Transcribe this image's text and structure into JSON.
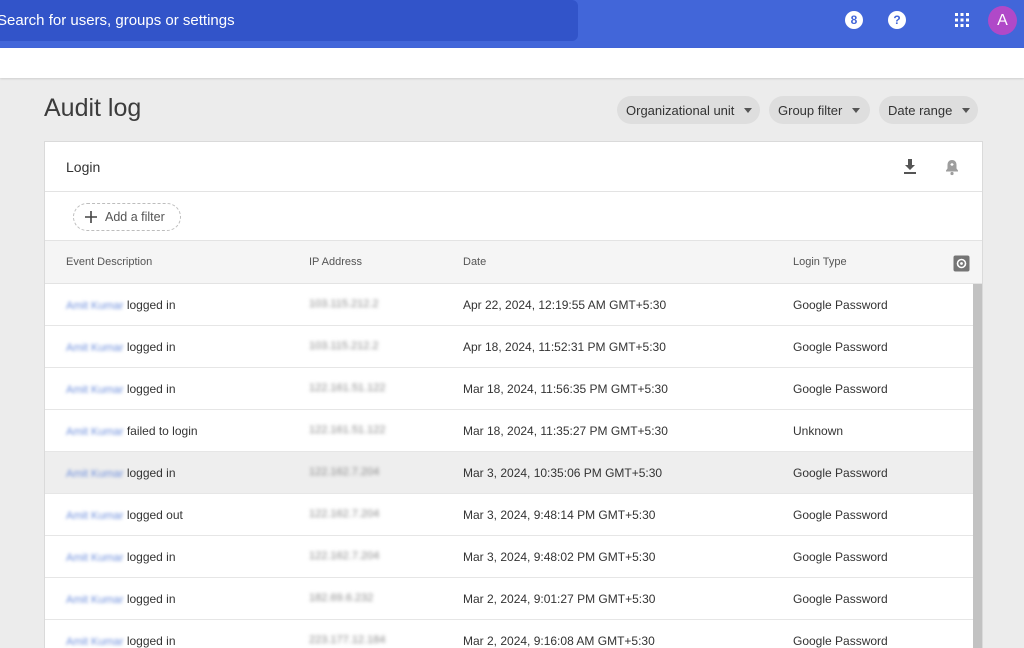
{
  "topbar": {
    "search_placeholder": "Search for users, groups or settings",
    "status_glyph": "8",
    "help_glyph": "?",
    "avatar_letter": "A"
  },
  "page": {
    "title": "Audit log"
  },
  "filters": {
    "org_unit": "Organizational unit",
    "group": "Group filter",
    "date_range": "Date range"
  },
  "card": {
    "title": "Login",
    "add_filter": "Add a filter"
  },
  "table": {
    "headers": {
      "event": "Event Description",
      "ip": "IP Address",
      "date": "Date",
      "login_type": "Login Type"
    },
    "rows": [
      {
        "user": "Amit Kumar",
        "action": "logged in",
        "ip": "103.115.212.2",
        "date": "Apr 22, 2024, 12:19:55 AM GMT+5:30",
        "type": "Google Password"
      },
      {
        "user": "Amit Kumar",
        "action": "logged in",
        "ip": "103.115.212.2",
        "date": "Apr 18, 2024, 11:52:31 PM GMT+5:30",
        "type": "Google Password"
      },
      {
        "user": "Amit Kumar",
        "action": "logged in",
        "ip": "122.161.51.122",
        "date": "Mar 18, 2024, 11:56:35 PM GMT+5:30",
        "type": "Google Password"
      },
      {
        "user": "Amit Kumar",
        "action": "failed to login",
        "ip": "122.161.51.122",
        "date": "Mar 18, 2024, 11:35:27 PM GMT+5:30",
        "type": "Unknown"
      },
      {
        "user": "Amit Kumar",
        "action": "logged in",
        "ip": "122.162.7.204",
        "date": "Mar 3, 2024, 10:35:06 PM GMT+5:30",
        "type": "Google Password"
      },
      {
        "user": "Amit Kumar",
        "action": "logged out",
        "ip": "122.162.7.204",
        "date": "Mar 3, 2024, 9:48:14 PM GMT+5:30",
        "type": "Google Password"
      },
      {
        "user": "Amit Kumar",
        "action": "logged in",
        "ip": "122.162.7.204",
        "date": "Mar 3, 2024, 9:48:02 PM GMT+5:30",
        "type": "Google Password"
      },
      {
        "user": "Amit Kumar",
        "action": "logged in",
        "ip": "182.69.6.232",
        "date": "Mar 2, 2024, 9:01:27 PM GMT+5:30",
        "type": "Google Password"
      },
      {
        "user": "Amit Kumar",
        "action": "logged in",
        "ip": "223.177.12.184",
        "date": "Mar 2, 2024, 9:16:08 AM GMT+5:30",
        "type": "Google Password"
      }
    ],
    "highlighted_row_index": 4
  },
  "colors": {
    "topbar": "#4266d9",
    "search": "#3254c9",
    "avatar": "#b049c8"
  },
  "icons": [
    "status-icon",
    "help-icon",
    "apps-grid-icon",
    "download-icon",
    "alert-bell-icon",
    "plus-icon",
    "settings-gear-icon",
    "caret-down-icon"
  ]
}
